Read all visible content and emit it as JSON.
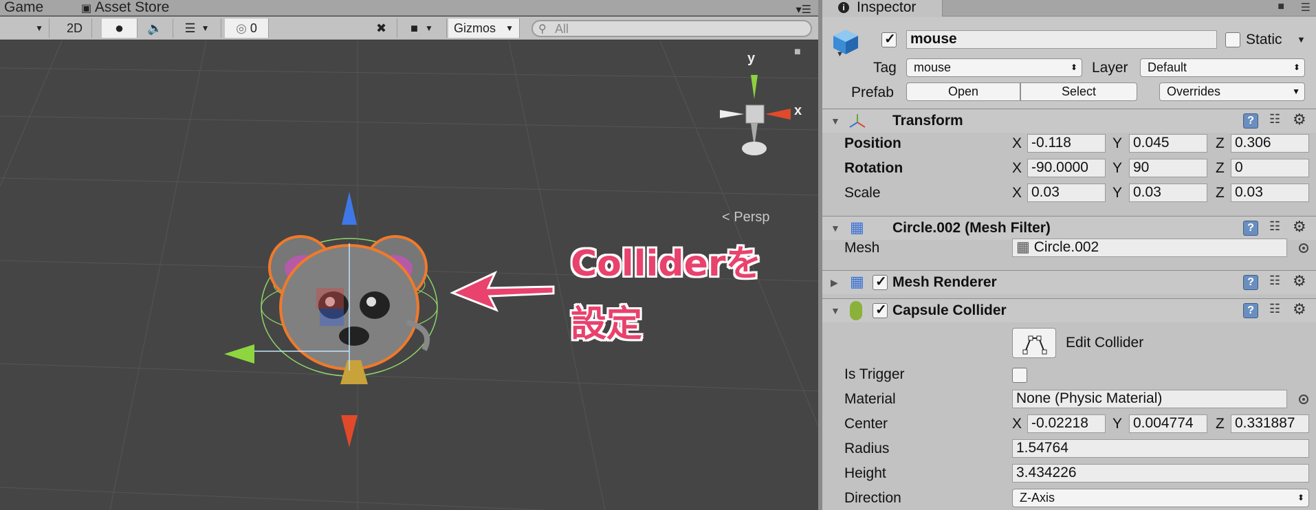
{
  "scene": {
    "tabs": {
      "game": "Game",
      "asset_store": "Asset Store"
    },
    "toolbar": {
      "mode_2d": "2D",
      "hidden_count": "0",
      "gizmos": "Gizmos",
      "search_placeholder": "All"
    },
    "gizmo": {
      "y_label": "y",
      "x_label": "x",
      "persp_label": "Persp"
    },
    "annotation": {
      "line1": "Colliderを",
      "line2": "設定",
      "color": "#e8426d"
    }
  },
  "inspector": {
    "tab_label": "Inspector",
    "header": {
      "name": "mouse",
      "static_label": "Static",
      "tag_label": "Tag",
      "tag_value": "mouse",
      "layer_label": "Layer",
      "layer_value": "Default",
      "prefab_label": "Prefab",
      "open_label": "Open",
      "select_label": "Select",
      "overrides_label": "Overrides"
    },
    "transform": {
      "title": "Transform",
      "position": {
        "label": "Position",
        "x": "-0.118",
        "y": "0.045",
        "z": "0.306"
      },
      "rotation": {
        "label": "Rotation",
        "x": "-90.0000",
        "y": "90",
        "z": "0"
      },
      "scale": {
        "label": "Scale",
        "x": "0.03",
        "y": "0.03",
        "z": "0.03"
      },
      "x_axis": "X",
      "y_axis": "Y",
      "z_axis": "Z"
    },
    "mesh_filter": {
      "title": "Circle.002 (Mesh Filter)",
      "mesh_label": "Mesh",
      "mesh_value": "Circle.002"
    },
    "mesh_renderer": {
      "title": "Mesh Renderer"
    },
    "capsule_collider": {
      "title": "Capsule Collider",
      "edit_collider_label": "Edit Collider",
      "is_trigger_label": "Is Trigger",
      "material_label": "Material",
      "material_value": "None (Physic Material)",
      "center_label": "Center",
      "center_x": "-0.02218",
      "center_y": "0.004774",
      "center_z": "0.331887",
      "radius_label": "Radius",
      "radius_value": "1.54764",
      "height_label": "Height",
      "height_value": "3.434226",
      "direction_label": "Direction",
      "direction_value": "Z-Axis"
    }
  }
}
